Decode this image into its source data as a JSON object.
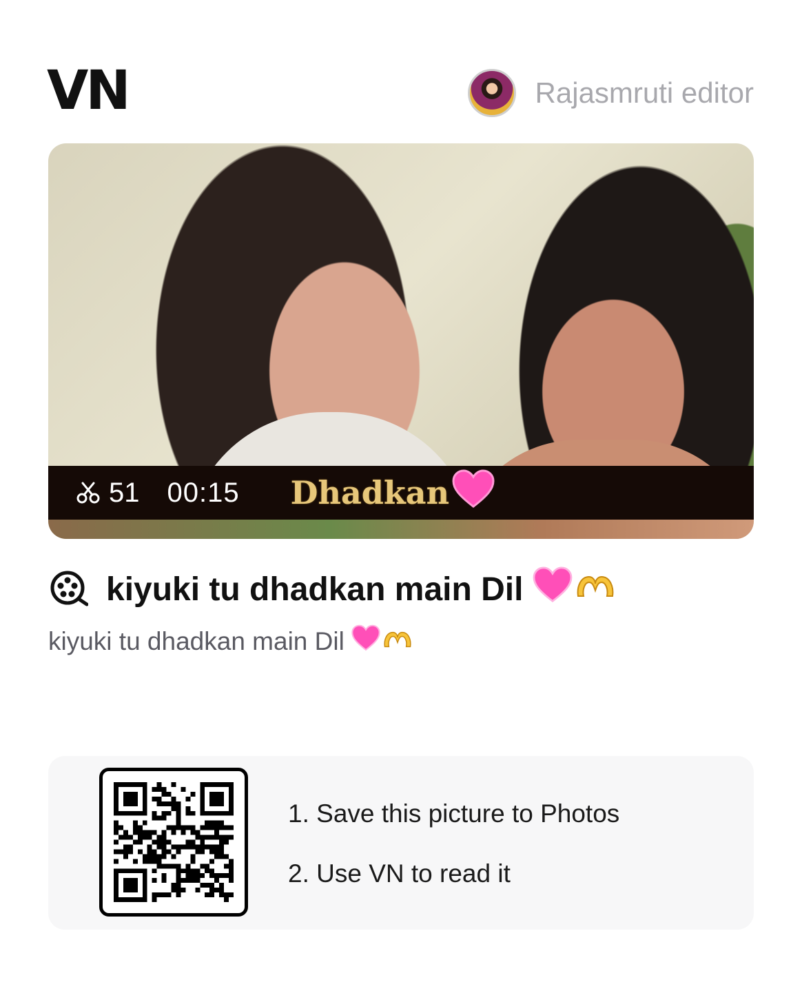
{
  "header": {
    "logo_text": "VN",
    "author_name": "Rajasmruti editor"
  },
  "thumbnail": {
    "clip_count": "51",
    "duration": "00:15",
    "overlay_title": "Dhadkan",
    "overlay_title_color": "#e7c77a",
    "info_bar_color": "#150a06"
  },
  "project": {
    "title": "kiyuki tu dhadkan main Dil",
    "description": "kiyuki tu dhadkan main Dil"
  },
  "qr_card": {
    "steps": [
      "1. Save this picture to Photos",
      "2. Use VN to read it"
    ]
  },
  "colors": {
    "accent_heart": "#ff4fb8",
    "text_primary": "#111111",
    "text_secondary": "#5a5a62",
    "author_gray": "#a8a8ad",
    "card_bg": "#f7f7f8"
  }
}
